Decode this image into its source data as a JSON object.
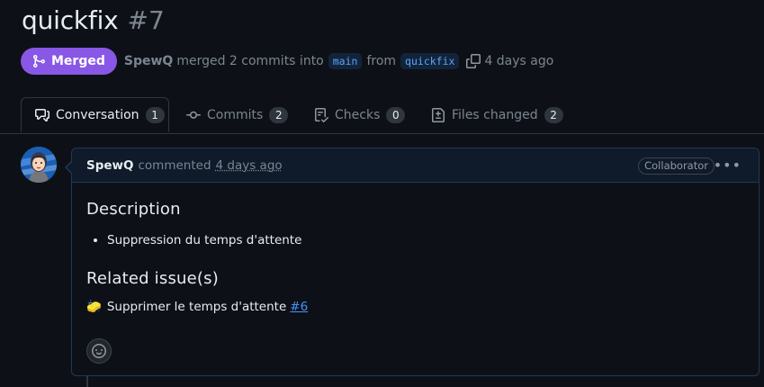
{
  "pr": {
    "title": "quickfix",
    "number": "#7",
    "status_label": "Merged",
    "author": "SpewQ",
    "merge_text": "merged 2 commits into",
    "base_branch": "main",
    "from_text": "from",
    "head_branch": "quickfix",
    "time": "4 days ago"
  },
  "tabs": [
    {
      "label": "Conversation",
      "count": "1",
      "icon": "comment-discussion-icon"
    },
    {
      "label": "Commits",
      "count": "2",
      "icon": "git-commit-icon"
    },
    {
      "label": "Checks",
      "count": "0",
      "icon": "checklist-icon"
    },
    {
      "label": "Files changed",
      "count": "2",
      "icon": "file-diff-icon"
    }
  ],
  "comment": {
    "author": "SpewQ",
    "action": "commented",
    "time": "4 days ago",
    "role": "Collaborator",
    "menu_label": "•••",
    "sections": [
      {
        "heading": "Description",
        "bullets": [
          "Suppression du temps d'attente"
        ]
      },
      {
        "heading": "Related issue(s)",
        "issue_text": "Supprimer le temps d'attente",
        "issue_link": "#6",
        "issue_emoji": "🧽"
      }
    ]
  },
  "colors": {
    "background": "#0d1117",
    "merged": "#8957e5",
    "link": "#4493f8",
    "comment_border": "#213858"
  }
}
